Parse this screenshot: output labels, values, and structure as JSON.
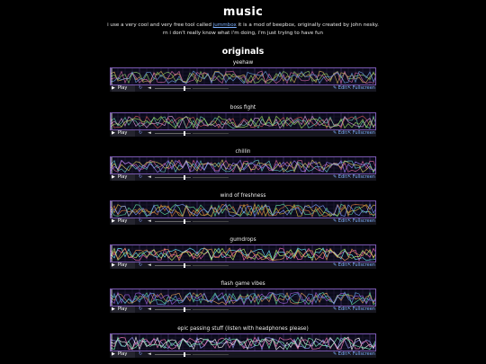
{
  "page": {
    "title": "music",
    "intro_line1_before": "i use a very cool and very free tool called ",
    "intro_link": "jummbox",
    "intro_line1_after": " it is a mod of beepbox, originally created by john nesky.",
    "intro_line2": "rn i don't really know what i'm doing, i'm just trying to have fun",
    "section_heading": "originals"
  },
  "controls": {
    "play_label": "Play",
    "play_icon": "play-triangle-icon",
    "loop_icon": "loop-icon",
    "volume_icon": "speaker-icon",
    "edit_label": "✎ Edit",
    "fullscreen_label": "⇱ Fullscreen"
  },
  "songs": [
    {
      "title": "yeehaw",
      "colors": [
        "#d9b45a",
        "#8fd06a",
        "#d46aa8",
        "#6aa0e0"
      ]
    },
    {
      "title": "boss fight",
      "colors": [
        "#d45a5a",
        "#6ad0b0",
        "#e0a0e0",
        "#a0e060"
      ]
    },
    {
      "title": "chillin",
      "colors": [
        "#e06aa0",
        "#6ad0d0",
        "#e0d06a",
        "#a080ff"
      ]
    },
    {
      "title": "wind of freshness",
      "colors": [
        "#e0c040",
        "#60e0a0",
        "#e08040",
        "#80a0ff"
      ]
    },
    {
      "title": "gumdrops",
      "colors": [
        "#ff70c0",
        "#70f0ff",
        "#c0ff70",
        "#ffa060"
      ]
    },
    {
      "title": "flash game vibes",
      "colors": [
        "#60e0a0",
        "#e0a060",
        "#a060e0",
        "#60a0e0"
      ]
    },
    {
      "title": "epic passing stuff (listen with headphones please)",
      "colors": [
        "#a0a0ff",
        "#ffffff",
        "#ff80c0",
        "#80ffc0"
      ]
    }
  ],
  "theme": {
    "accent": "#7a58b0",
    "link": "#7fb2ff",
    "background": "#000000"
  }
}
